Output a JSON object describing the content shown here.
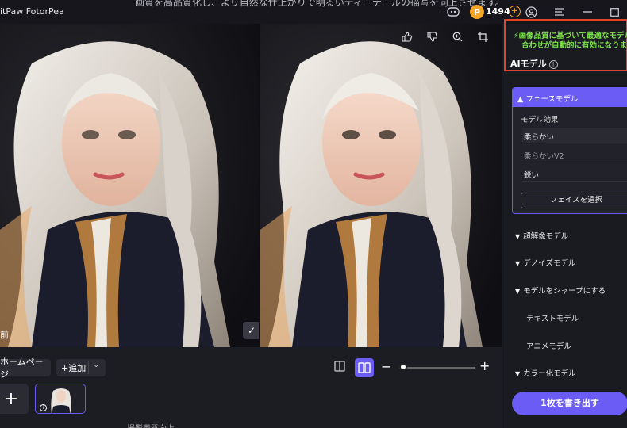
{
  "window": {
    "app_title": "itPaw FotorPea",
    "overlay_top_text": "画質を高品質化し、より自然な仕上がりで明るいディーテールの描写を向上させます。",
    "coin_count": "1494",
    "coin_symbol": "P"
  },
  "preview": {
    "original_label": "前",
    "check_symbol": "✓"
  },
  "bottom": {
    "home_label": "ホームページ",
    "add_label": "+追加",
    "add_chevron": "⌄",
    "zoom_minus": "−",
    "zoom_plus": "+",
    "zoom_level": 0.03,
    "thumb_add": "+",
    "overlay_bottom_text": "撮影画質向上"
  },
  "panel": {
    "notice_line1": "画像品質に基づいて最適なモデルの組み",
    "notice_line2": "合わせが自動的に有効になります。",
    "ai_model_label": "AIモデル",
    "face_model_label": "フェースモデル",
    "model_effect_label": "モデル効果",
    "options": [
      "柔らかい",
      "柔らかいV2",
      "鋭い"
    ],
    "face_select_label": "フェイスを選択",
    "sections": [
      "超解像モデル",
      "デノイズモデル",
      "モデルをシャープにする",
      "テキストモデル",
      "アニメモデル",
      "カラー化モデル"
    ],
    "export_label": "1枚を書き出す"
  },
  "colors": {
    "accent": "#6b5cf6",
    "notice_border": "#e0452b",
    "notice_text": "#7ee24a",
    "coin": "#f5a623"
  }
}
